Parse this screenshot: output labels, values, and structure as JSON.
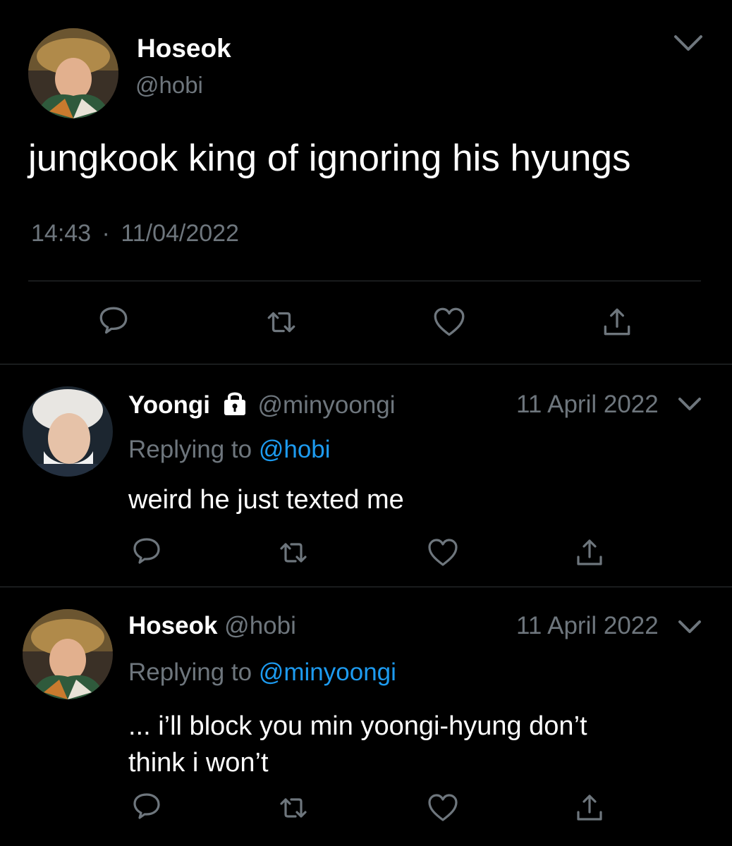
{
  "main_tweet": {
    "display_name": "Hoseok",
    "handle": "@hobi",
    "text": "jungkook king of ignoring his hyungs",
    "time": "14:43",
    "separator": "·",
    "date": "11/04/2022",
    "avatar_icon": "user-photo-avatar"
  },
  "replies": [
    {
      "display_name": "Yoongi",
      "protected_icon": "lock-icon",
      "handle": "@minyoongi",
      "date": "11 April 2022",
      "replying_prefix": "Replying to",
      "replying_handle": "@hobi",
      "text_lines": [
        "weird he just texted me"
      ]
    },
    {
      "display_name": "Hoseok",
      "handle": "@hobi",
      "date": "11 April 2022",
      "replying_prefix": "Replying to",
      "replying_handle": "@minyoongi",
      "text_lines": [
        "... i’ll block you min yoongi-hyung don’t",
        "think i won’t"
      ]
    }
  ],
  "action_icons": [
    "reply-icon",
    "retweet-icon",
    "like-icon",
    "share-icon"
  ],
  "colors": {
    "background": "#000000",
    "text": "#ffffff",
    "muted": "#6e767d",
    "link": "#1d9bf0",
    "divider": "#2f3336"
  }
}
